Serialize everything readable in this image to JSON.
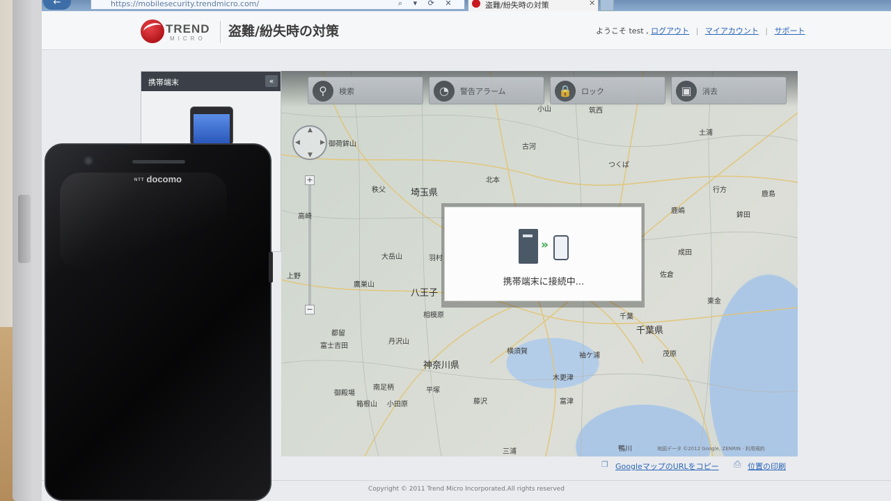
{
  "browser": {
    "back_glyph": "←",
    "address": "https://mobilesecurity.trendmicro.com/",
    "address_icons": "⌕ ▾ ⟳ ✕",
    "tab_title": "盗難/紛失時の対策",
    "tab_close": "✕"
  },
  "header": {
    "logo_trend": "TREND",
    "logo_micro": "MICRO",
    "title": "盗難/紛失時の対策",
    "welcome": "ようこそ test ,",
    "logout": "ログアウト",
    "my_account": "マイアカウント",
    "support": "サポート",
    "separator": "|"
  },
  "device_panel": {
    "title": "携帯端末",
    "collapse_glyph": "«"
  },
  "map": {
    "toolbar": [
      {
        "label": "検索",
        "icon": "location-pin-icon",
        "glyph": "⚲"
      },
      {
        "label": "警告アラーム",
        "icon": "alarm-icon",
        "glyph": "◔"
      },
      {
        "label": "ロック",
        "icon": "lock-icon",
        "glyph": "🔒"
      },
      {
        "label": "消去",
        "icon": "trash-icon",
        "glyph": "▣"
      }
    ],
    "zoom_in": "+",
    "zoom_out": "−",
    "labels": [
      "小山",
      "筑西",
      "古河",
      "つくば",
      "土浦",
      "北本",
      "秩父",
      "埼玉県",
      "大岳山",
      "羽村",
      "鷹巣山",
      "八王子",
      "相模原",
      "都留",
      "富士吉田",
      "丹沢山",
      "神奈川県",
      "横須賀",
      "木更津",
      "千葉",
      "千葉県",
      "袖ケ浦",
      "茂原",
      "成田",
      "佐倉",
      "鹿嶋",
      "行方",
      "富津",
      "鴨川",
      "南足柄",
      "小田原",
      "箱根山",
      "平塚",
      "藤沢",
      "三浦",
      "御殿場",
      "鉾田",
      "東金",
      "高崎",
      "上野",
      "御荷鉾山",
      "鹿島"
    ],
    "attribution": "地図データ ©2012 Google, ZENRIN · 利用規約"
  },
  "modal": {
    "message": "携帯端末に接続中...",
    "icons": [
      "server-icon",
      "arrow-icon",
      "phone-icon"
    ],
    "arrow_glyph": "»"
  },
  "footer": {
    "copy_map_url": "GoogleマップのURLをコピー",
    "print_location": "位置の印刷",
    "copyright": "Copyright © 2011 Trend Micro Incorporated.All rights reserved"
  },
  "phone": {
    "brand_prefix": "NTT",
    "brand": "docomo"
  },
  "colors": {
    "accent_red": "#c8191f",
    "link_blue": "#2a64b8",
    "panel_dark": "#3b4048",
    "modal_arrow_green": "#3ba64a"
  }
}
